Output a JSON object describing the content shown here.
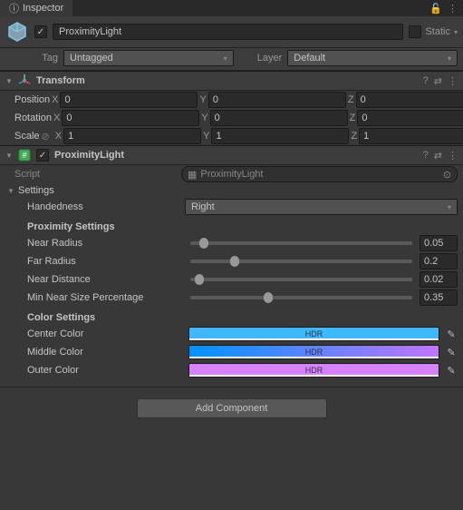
{
  "tab": {
    "title": "Inspector"
  },
  "header": {
    "enabled_checked": true,
    "name": "ProximityLight",
    "static_label": "Static"
  },
  "tagLayer": {
    "tag_label": "Tag",
    "tag_value": "Untagged",
    "layer_label": "Layer",
    "layer_value": "Default"
  },
  "transform": {
    "title": "Transform",
    "position_label": "Position",
    "rotation_label": "Rotation",
    "scale_label": "Scale",
    "x": "X",
    "y": "Y",
    "z": "Z",
    "pos": {
      "x": "0",
      "y": "0",
      "z": "0"
    },
    "rot": {
      "x": "0",
      "y": "0",
      "z": "0"
    },
    "scl": {
      "x": "1",
      "y": "1",
      "z": "1"
    }
  },
  "proxLight": {
    "title": "ProximityLight",
    "script_label": "Script",
    "script_value": "ProximityLight",
    "settings_label": "Settings",
    "handedness_label": "Handedness",
    "handedness_value": "Right",
    "proximity_heading": "Proximity Settings",
    "near_radius_label": "Near Radius",
    "near_radius_value": "0.05",
    "far_radius_label": "Far Radius",
    "far_radius_value": "0.2",
    "near_distance_label": "Near Distance",
    "near_distance_value": "0.02",
    "min_near_label": "Min Near Size Percentage",
    "min_near_value": "0.35",
    "color_heading": "Color Settings",
    "center_label": "Center Color",
    "middle_label": "Middle Color",
    "outer_label": "Outer Color",
    "hdr": "HDR",
    "colors": {
      "center": "#3fb8ff",
      "middle_start": "#0092ff",
      "middle_end": "#c175ff",
      "outer": "#d681ff"
    }
  },
  "addComponent": "Add Component"
}
